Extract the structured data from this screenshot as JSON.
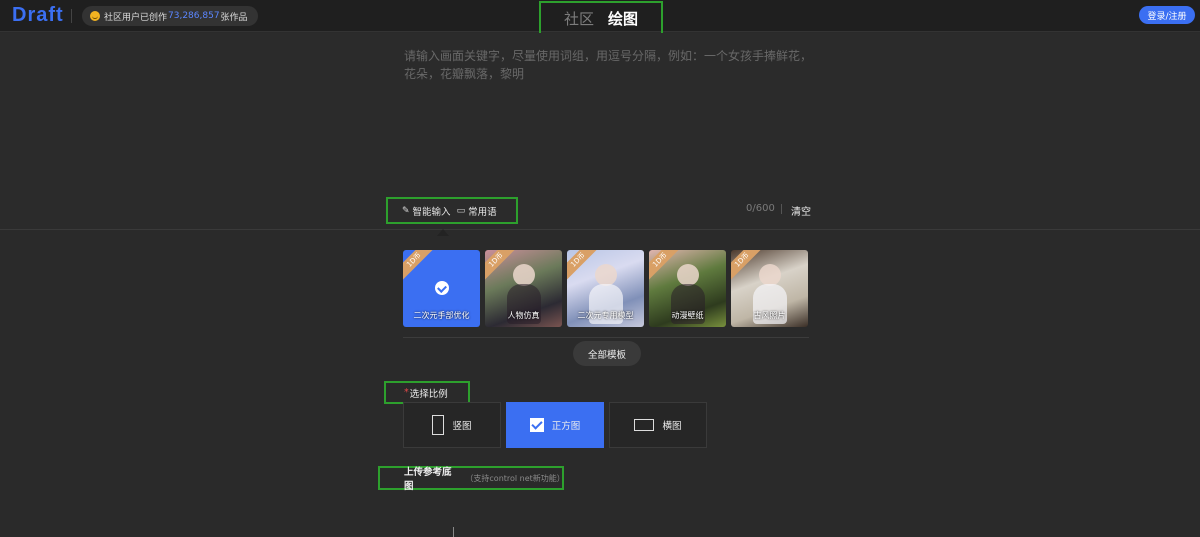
{
  "header": {
    "logo": "Draft",
    "stats_prefix": "社区用户已创作",
    "stats_count": "73,286,857",
    "stats_suffix": "张作品",
    "tabs": [
      "社区",
      "绘图"
    ],
    "active_tab": "绘图",
    "login_label": "登录/注册"
  },
  "prompt": {
    "placeholder": "请输入画面关键字，尽量使用词组，用逗号分隔，例如：一个女孩手捧鲜花，花朵，花瓣飘落，黎明",
    "smart_input_label": "智能输入",
    "common_phrases_label": "常用语",
    "char_count": "0/600",
    "clear_label": "清空"
  },
  "templates": {
    "items": [
      {
        "label": "二次元手部优化",
        "badge": "1D币",
        "selected": true
      },
      {
        "label": "人物仿真",
        "badge": "1D币",
        "selected": false
      },
      {
        "label": "二次元专用模型",
        "badge": "1D币",
        "selected": false
      },
      {
        "label": "动漫壁纸",
        "badge": "1D币",
        "selected": false
      },
      {
        "label": "古风照片",
        "badge": "1D币",
        "selected": false
      }
    ],
    "all_label": "全部模板"
  },
  "ratio": {
    "required_mark": "*",
    "title": "选择比例",
    "options": [
      {
        "label": "竖图",
        "icon": "portrait-icon",
        "selected": false
      },
      {
        "label": "正方图",
        "icon": "square-check-icon",
        "selected": true
      },
      {
        "label": "横图",
        "icon": "landscape-icon",
        "selected": false
      }
    ]
  },
  "upload": {
    "title": "上传参考底图",
    "hint": "（支持control net新功能）"
  },
  "colors": {
    "accent": "#3b6ff2",
    "background": "#2a2a2a",
    "highlight_box": "#2da02d",
    "badge": "#d9a066"
  }
}
